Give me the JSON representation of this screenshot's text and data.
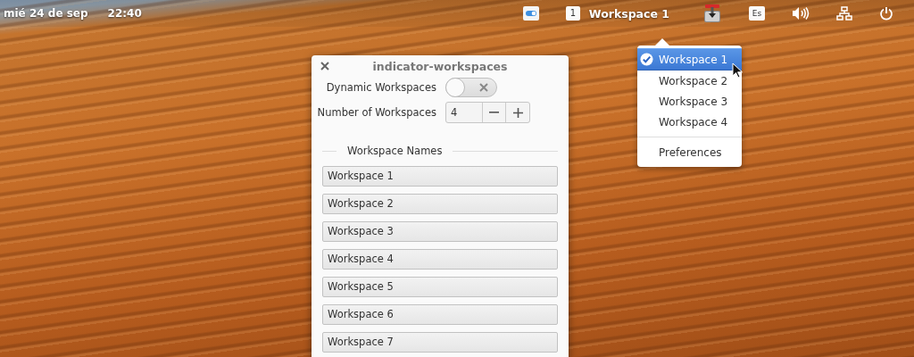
{
  "panel": {
    "date": "mié 24 de sep",
    "time": "22:40",
    "workspace_number": "1",
    "workspace_name": "Workspace 1",
    "keyboard_layout": "Es"
  },
  "menu": {
    "items": [
      {
        "label": "Workspace 1",
        "selected": true
      },
      {
        "label": "Workspace 2",
        "selected": false
      },
      {
        "label": "Workspace 3",
        "selected": false
      },
      {
        "label": "Workspace 4",
        "selected": false
      }
    ],
    "preferences": "Preferences"
  },
  "dialog": {
    "title": "indicator-workspaces",
    "dynamic_workspaces": {
      "label": "Dynamic Workspaces",
      "on": false
    },
    "number_of_workspaces": {
      "label": "Number of Workspaces",
      "value": "4"
    },
    "section": "Workspace Names",
    "names": [
      "Workspace 1",
      "Workspace 2",
      "Workspace 3",
      "Workspace 4",
      "Workspace 5",
      "Workspace 6",
      "Workspace 7"
    ]
  }
}
